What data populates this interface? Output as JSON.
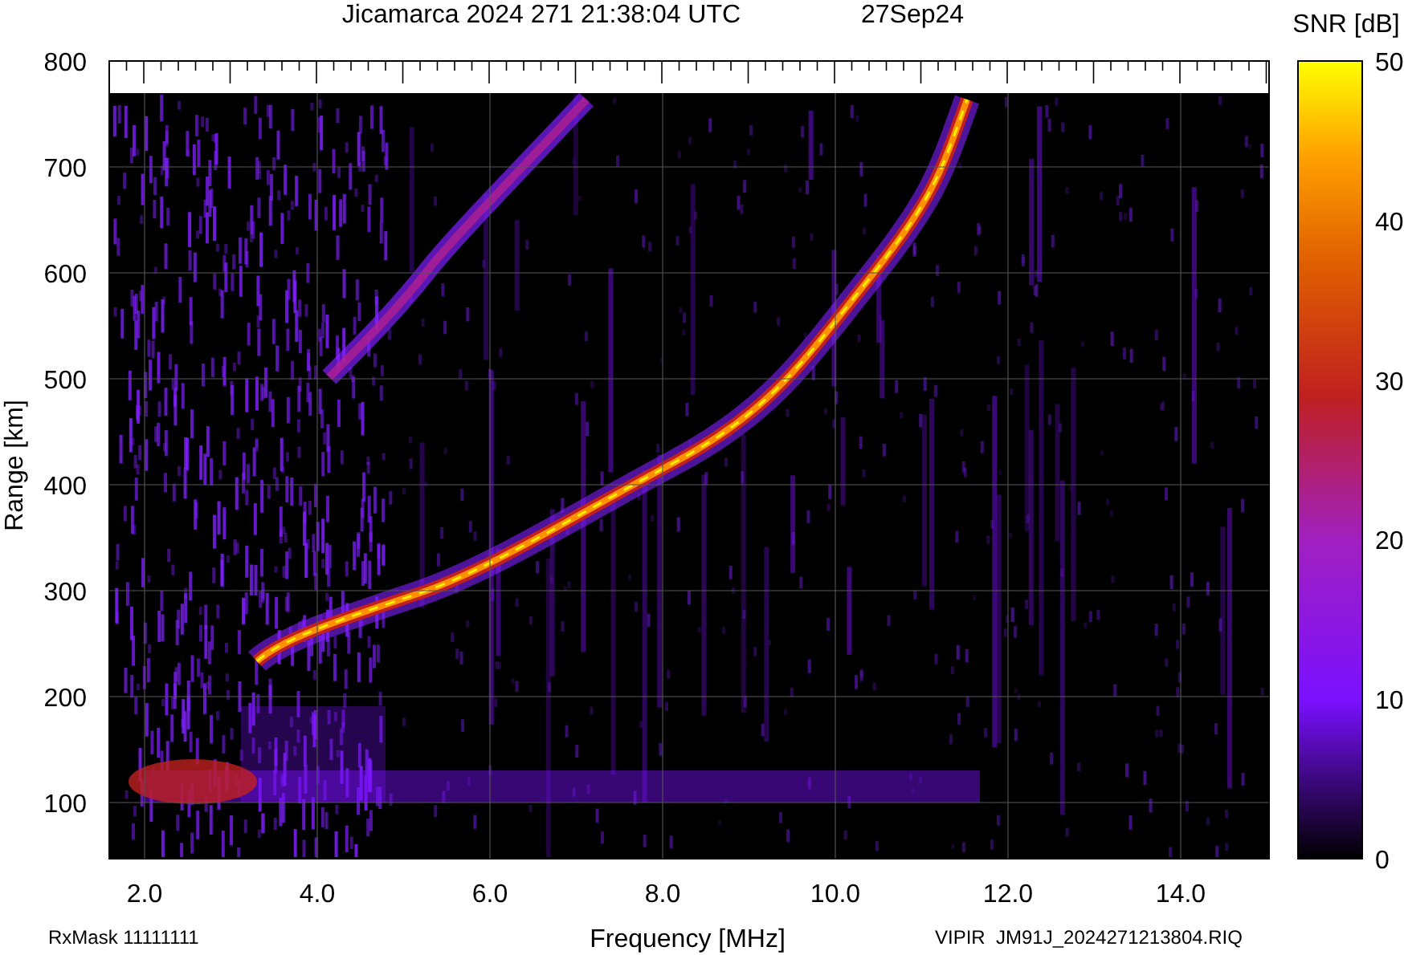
{
  "title": "Jicamarca 2024 271 21:38:04 UTC",
  "date": "27Sep24",
  "colorbar": {
    "label": "SNR [dB]",
    "ticks": [
      "50",
      "40",
      "30",
      "20",
      "10",
      "0"
    ]
  },
  "y_axis": {
    "label": "Range [km]",
    "ticks": [
      "800",
      "700",
      "600",
      "500",
      "400",
      "300",
      "200",
      "100"
    ]
  },
  "x_axis": {
    "label": "Frequency [MHz]",
    "ticks": [
      "2.0",
      "4.0",
      "6.0",
      "8.0",
      "10.0",
      "12.0",
      "14.0"
    ]
  },
  "footer_left": "RxMask 11111111",
  "footer_right": "VIPIR  JM91J_2024271213804.RIQ"
}
